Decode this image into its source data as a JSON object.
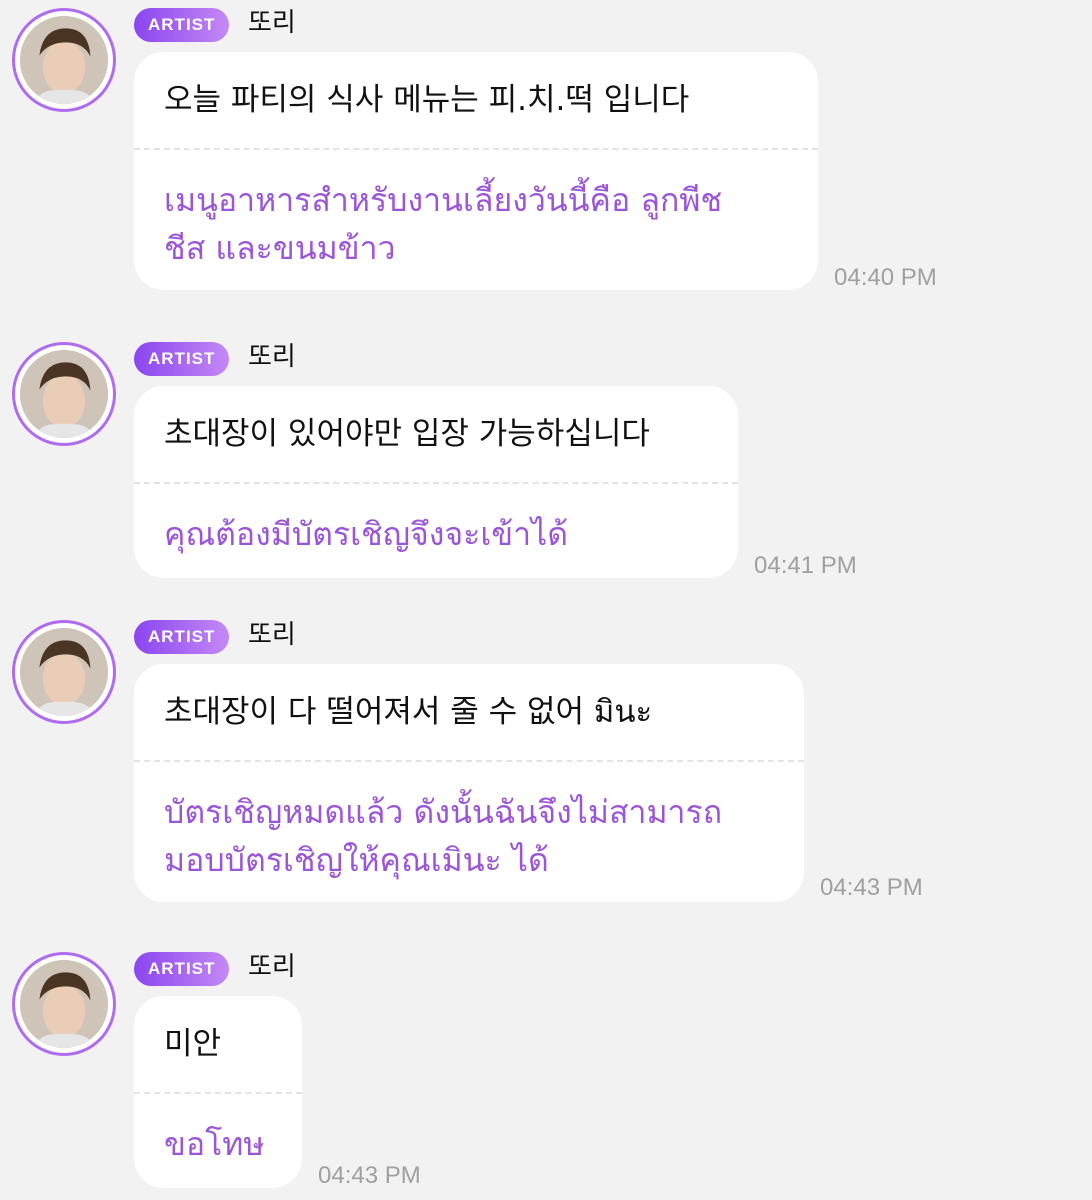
{
  "messages": [
    {
      "badge": "ARTIST",
      "name": "또리",
      "original": "오늘 파티의 식사 메뉴는 피.치.떡 입니다",
      "translation_lines": [
        "เมนูอาหารสำหรับงานเลี้ยงวันนี้คือ ลูกพีช",
        "ชีส และขนมข้าว"
      ],
      "time": "04:40 PM"
    },
    {
      "badge": "ARTIST",
      "name": "또리",
      "original": "초대장이 있어야만 입장 가능하십니다",
      "translation_lines": [
        "คุณต้องมีบัตรเชิญจึงจะเข้าได้"
      ],
      "time": "04:41 PM"
    },
    {
      "badge": "ARTIST",
      "name": "또리",
      "original": "초대장이 다 떨어져서 줄 수 없어 มินะ",
      "translation_lines": [
        "บัตรเชิญหมดแล้ว ดังนั้นฉันจึงไม่สามารถ",
        "มอบบัตรเชิญให้คุณเมินะ ได้"
      ],
      "time": "04:43 PM"
    },
    {
      "badge": "ARTIST",
      "name": "또리",
      "original": "미안",
      "translation_lines": [
        "ขอโทษ"
      ],
      "time": "04:43 PM"
    }
  ]
}
